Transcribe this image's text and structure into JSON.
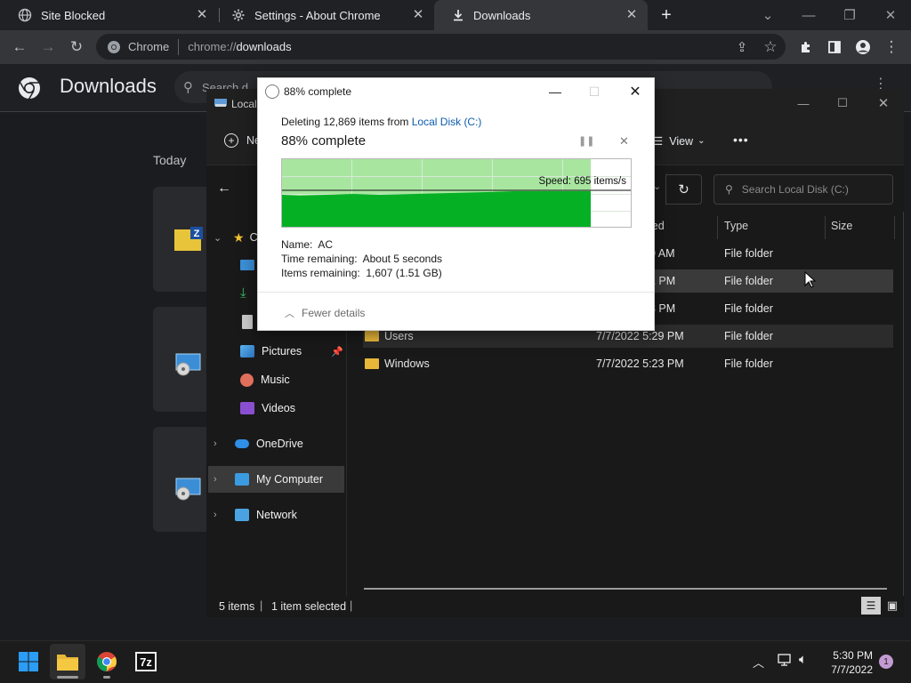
{
  "chrome": {
    "tabs": [
      {
        "title": "Site Blocked",
        "icon": "globe-icon"
      },
      {
        "title": "Settings - About Chrome",
        "icon": "gear-icon"
      },
      {
        "title": "Downloads",
        "icon": "download-icon",
        "active": true
      }
    ],
    "omnibox": {
      "chip": "Chrome",
      "url_scheme": "chrome://",
      "url_path": "downloads"
    },
    "downloads_page": {
      "title": "Downloads",
      "search_placeholder": "Search d",
      "section": "Today"
    }
  },
  "explorer": {
    "title": "Local",
    "new_label": "Ne",
    "view_label": "View",
    "more_label": "•••",
    "search_placeholder": "Search Local Disk (C:)",
    "columns": {
      "modified": "ied",
      "type": "Type",
      "size": "Size"
    },
    "nav": {
      "quick_access_letter": "C",
      "pictures": "Pictures",
      "music": "Music",
      "videos": "Videos",
      "onedrive": "OneDrive",
      "my_computer": "My Computer",
      "network": "Network"
    },
    "rows": [
      {
        "name": "",
        "date": "0 AM",
        "type": "File folder"
      },
      {
        "name": "",
        "date": "1 PM",
        "type": "File folder"
      },
      {
        "name": "",
        "date": "3 PM",
        "type": "File folder"
      },
      {
        "name": "Users",
        "date": "7/7/2022 5:29 PM",
        "type": "File folder"
      },
      {
        "name": "Windows",
        "date": "7/7/2022 5:23 PM",
        "type": "File folder"
      }
    ],
    "status": {
      "items": "5 items",
      "selected": "1 item selected"
    }
  },
  "dialog": {
    "title": "88% complete",
    "deleting_prefix": "Deleting 12,869 items from ",
    "location": "Local Disk (C:)",
    "headline": "88% complete",
    "speed": "Speed: 695 items/s",
    "progress_fraction": 0.88,
    "details": [
      {
        "label": "Name:",
        "value": "AC"
      },
      {
        "label": "Time remaining:",
        "value": "About 5 seconds"
      },
      {
        "label": "Items remaining:",
        "value": "1,607 (1.51 GB)"
      }
    ],
    "fewer_details": "Fewer details"
  },
  "taskbar": {
    "time": "5:30 PM",
    "date": "7/7/2022",
    "badge": "1",
    "sevenzip": "7z"
  },
  "colors": {
    "accent": "#0f6cbd",
    "progress_fill": "#06b025",
    "progress_bg": "#a8e6a0",
    "link": "#0b5cad"
  }
}
